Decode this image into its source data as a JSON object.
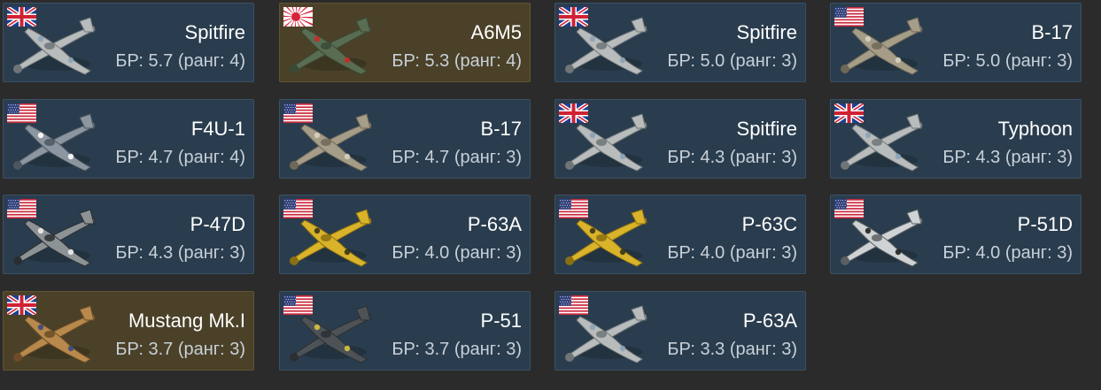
{
  "cards": [
    {
      "name": "Spitfire",
      "br": "БР: 5.7 (ранг: 4)",
      "nation": "uk",
      "flag_icon": "uk-flag-icon",
      "plane_icon": "spitfire-icon",
      "tint": "normal",
      "scheme": "grey"
    },
    {
      "name": "A6M5",
      "br": "БР: 5.3 (ранг: 4)",
      "nation": "japan",
      "flag_icon": "japan-flag-icon",
      "plane_icon": "a6m5-icon",
      "tint": "elite",
      "scheme": "green"
    },
    {
      "name": "Spitfire",
      "br": "БР: 5.0 (ранг: 3)",
      "nation": "uk",
      "flag_icon": "uk-flag-icon",
      "plane_icon": "spitfire-icon",
      "tint": "normal",
      "scheme": "grey"
    },
    {
      "name": "B-17",
      "br": "БР: 5.0 (ранг: 3)",
      "nation": "usa",
      "flag_icon": "usa-flag-icon",
      "plane_icon": "b17-icon",
      "tint": "normal",
      "scheme": "bomber"
    },
    {
      "name": "F4U-1",
      "br": "БР: 4.7 (ранг: 4)",
      "nation": "usa",
      "flag_icon": "usa-flag-icon",
      "plane_icon": "f4u-icon",
      "tint": "normal",
      "scheme": "navy"
    },
    {
      "name": "B-17",
      "br": "БР: 4.7 (ранг: 3)",
      "nation": "usa",
      "flag_icon": "usa-flag-icon",
      "plane_icon": "b17-icon",
      "tint": "normal",
      "scheme": "bomber"
    },
    {
      "name": "Spitfire",
      "br": "БР: 4.3 (ранг: 3)",
      "nation": "uk",
      "flag_icon": "uk-flag-icon",
      "plane_icon": "spitfire-icon",
      "tint": "normal",
      "scheme": "grey"
    },
    {
      "name": "Typhoon",
      "br": "БР: 4.3 (ранг: 3)",
      "nation": "uk",
      "flag_icon": "uk-flag-icon",
      "plane_icon": "typhoon-icon",
      "tint": "normal",
      "scheme": "grey"
    },
    {
      "name": "P-47D",
      "br": "БР: 4.3 (ранг: 3)",
      "nation": "usa",
      "flag_icon": "usa-flag-icon",
      "plane_icon": "p47d-icon",
      "tint": "normal",
      "scheme": "stripes"
    },
    {
      "name": "P-63A",
      "br": "БР: 4.0 (ранг: 3)",
      "nation": "usa",
      "flag_icon": "usa-flag-icon",
      "plane_icon": "p63a-icon",
      "tint": "normal",
      "scheme": "yellow"
    },
    {
      "name": "P-63C",
      "br": "БР: 4.0 (ранг: 3)",
      "nation": "usa",
      "flag_icon": "usa-flag-icon",
      "plane_icon": "p63c-icon",
      "tint": "normal",
      "scheme": "yellow"
    },
    {
      "name": "P-51D",
      "br": "БР: 4.0 (ранг: 3)",
      "nation": "usa",
      "flag_icon": "usa-flag-icon",
      "plane_icon": "p51d-icon",
      "tint": "normal",
      "scheme": "silver"
    },
    {
      "name": "Mustang Mk.I",
      "br": "БР: 3.7 (ранг: 3)",
      "nation": "uk",
      "flag_icon": "uk-flag-icon",
      "plane_icon": "mustang-mk1-icon",
      "tint": "elite",
      "scheme": "desert"
    },
    {
      "name": "P-51",
      "br": "БР: 3.7 (ранг: 3)",
      "nation": "usa",
      "flag_icon": "usa-flag-icon",
      "plane_icon": "p51-icon",
      "tint": "normal",
      "scheme": "dark"
    },
    {
      "name": "P-63A",
      "br": "БР: 3.3 (ранг: 3)",
      "nation": "usa",
      "flag_icon": "usa-flag-icon",
      "plane_icon": "p63a-icon",
      "tint": "normal",
      "scheme": "grey"
    }
  ],
  "colors": {
    "background": "#2b2b2b",
    "card": "#2a3d4e",
    "card_border": "#3a5064",
    "card_elite": "#4a4128",
    "name_text": "#ffffff",
    "br_text": "#c8d0d8"
  }
}
